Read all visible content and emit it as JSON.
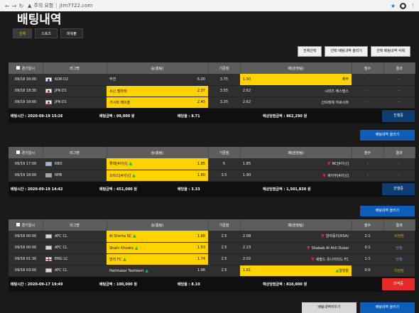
{
  "browser": {
    "back_icon": "back-arrow-icon",
    "forward_icon": "forward-arrow-icon",
    "refresh_icon": "refresh-icon",
    "warning_text": "주의 요함",
    "url": "jtm7722.com"
  },
  "page": {
    "title": "배팅내역",
    "tabs": [
      "전체",
      "스포츠",
      "파워볼"
    ],
    "actions": [
      "전체선택",
      "선택 배팅내역 올리기",
      "선택 배팅내역 삭제"
    ]
  },
  "table_headers": [
    "경기일시",
    "리그명",
    "승(홈팀)",
    "기준점",
    "패(원정팀)",
    "점수",
    "결과"
  ],
  "bets": [
    {
      "rows": [
        {
          "datetime": "09/18 16:00",
          "league_flag": "KOR",
          "league": "KOR D2",
          "home": "부천",
          "home_odds": "6.00",
          "base": "3.75",
          "away_odds": "1.50",
          "away": "제주",
          "score": ":",
          "result": "-",
          "home_selected": false,
          "away_selected": true,
          "home_trend": "",
          "away_trend": ""
        },
        {
          "datetime": "09/18 18:30",
          "league_flag": "JPN",
          "league": "JPN D1",
          "home": "소난 벨마레",
          "home_odds": "2.37",
          "base": "3.55",
          "away_odds": "2.62",
          "away": "시미즈 에스펄스",
          "score": ":",
          "result": "-",
          "home_selected": true,
          "away_selected": false,
          "home_trend": "",
          "away_trend": ""
        },
        {
          "datetime": "09/19 18:00",
          "league_flag": "JPN",
          "league": "JPN D1",
          "home": "가시와 레이솔",
          "home_odds": "2.45",
          "base": "3.25",
          "away_odds": "2.62",
          "away": "산프레체 히로시마",
          "score": ":",
          "result": "-",
          "home_selected": true,
          "away_selected": false,
          "home_trend": "",
          "away_trend": ""
        }
      ],
      "summary": {
        "bet_time": "배팅시간 : 2020-09-19 15:26",
        "bet_amount": "배팅금액 : 99,000 원",
        "bet_odds": "배당율 : 8.71",
        "expected": "예상당첨금액 : 862,290 원",
        "status": "진행중",
        "status_type": "progress"
      },
      "upload_label": "배팅내역 올리기"
    },
    {
      "rows": [
        {
          "datetime": "09/19 17:00",
          "league_flag": "KBO",
          "league": "KBO",
          "home": "롯데[4이닝]",
          "home_odds": "1.85",
          "base": "5",
          "away_odds": "1.85",
          "away": "NC[4이닝]",
          "score": ":",
          "result": "-",
          "home_selected": true,
          "away_selected": false,
          "home_trend": "up",
          "away_trend": "down"
        },
        {
          "datetime": "09/19 18:00",
          "league_flag": "NPB",
          "league": "NPB",
          "home": "오릭스[4이닝]",
          "home_odds": "1.80",
          "base": "3.5",
          "away_odds": "1.90",
          "away": "세이부[4이닝]",
          "score": ":",
          "result": "-",
          "home_selected": true,
          "away_selected": false,
          "home_trend": "up",
          "away_trend": "down"
        }
      ],
      "summary": {
        "bet_time": "배팅시간 : 2020-09-19 14:42",
        "bet_amount": "배팅금액 : 451,000 원",
        "bet_odds": "배당율 : 3.33",
        "expected": "예상당첨금액 : 1,501,830 원",
        "status": "진행중",
        "status_type": "progress"
      },
      "upload_label": "배팅내역 올리기"
    },
    {
      "rows": [
        {
          "datetime": "09/18 00:00",
          "league_flag": "AFC",
          "league": "AFC CL",
          "home": "Al Shorta SC",
          "home_odds": "1.68",
          "base": "2.5",
          "away_odds": "2.08",
          "away": "알아흘리(KSA)",
          "score": "2:1",
          "result": "미당첨",
          "home_selected": true,
          "away_selected": false,
          "home_trend": "up",
          "away_trend": "down"
        },
        {
          "datetime": "09/18 00:00",
          "league_flag": "AFC",
          "league": "AFC CL",
          "home": "Shahr Khodro",
          "home_odds": "1.53",
          "base": "2.5",
          "away_odds": "2.23",
          "away": "Shabab Al Ahli Dubai",
          "score": "0:1",
          "result": "당첨",
          "home_selected": true,
          "away_selected": false,
          "home_trend": "up",
          "away_trend": "down"
        },
        {
          "datetime": "09/18 01:30",
          "league_flag": "ENG",
          "league": "ENG LC",
          "home": "번리 FC",
          "home_odds": "1.74",
          "base": "2.5",
          "away_odds": "2.02",
          "away": "셰필드 유나이티드 FC",
          "score": "1:1",
          "result": "당첨",
          "home_selected": true,
          "away_selected": false,
          "home_trend": "up",
          "away_trend": "down"
        },
        {
          "datetime": "09/18 03:00",
          "league_flag": "AFC",
          "league": "AFC CL",
          "home": "Pakhtakor Tashkent",
          "home_odds": "1.96",
          "base": "2.5",
          "away_odds": "1.81",
          "away": "알힐랄",
          "score": "0:0",
          "result": "미당첨",
          "home_selected": false,
          "away_selected": true,
          "home_trend": "up",
          "away_trend": "up"
        }
      ],
      "summary": {
        "bet_time": "배팅시간 : 2020-09-17 19:49",
        "bet_amount": "배팅금액 : 100,000 원",
        "bet_odds": "배당율 : 8.10",
        "expected": "예상당첨금액 : 810,000 원",
        "status": "미적중",
        "status_type": "lose"
      },
      "upload_label": "배팅내역 올리기",
      "hide_label": "배팅내역지우기"
    }
  ],
  "colors": {
    "selected": "#ffd200",
    "progress": "#0b3d73",
    "lose": "#e62a2a",
    "upload": "#0e5db8"
  }
}
